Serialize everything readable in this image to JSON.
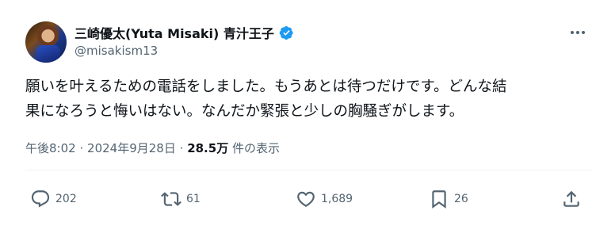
{
  "author": {
    "display_name": "三崎優太(Yuta Misaki) 青汁王子",
    "handle": "@misakism13",
    "verified_color": "#1d9bf0"
  },
  "tweet": {
    "text_line1": "願いを叶えるための電話をしました。もうあとは待つだけです。どんな結",
    "text_line2": "果になろうと悔いはない。なんだか緊張と少しの胸騒ぎがします。"
  },
  "meta": {
    "time": "午後8:02",
    "separator1": "·",
    "date": "2024年9月28日",
    "separator2": "·",
    "views_count": "28.5万",
    "views_label": "件の表示"
  },
  "actions": {
    "reply_count": "202",
    "retweet_count": "61",
    "like_count": "1,689",
    "bookmark_count": "26"
  },
  "icons": {
    "avatar": "avatar-image",
    "verified": "verified-badge-icon",
    "more": "more-horizontal-icon",
    "reply": "reply-icon",
    "retweet": "retweet-icon",
    "like": "heart-icon",
    "bookmark": "bookmark-icon",
    "share": "share-icon"
  },
  "colors": {
    "text_primary": "#0f1419",
    "text_secondary": "#536471",
    "divider": "#eff3f4"
  }
}
